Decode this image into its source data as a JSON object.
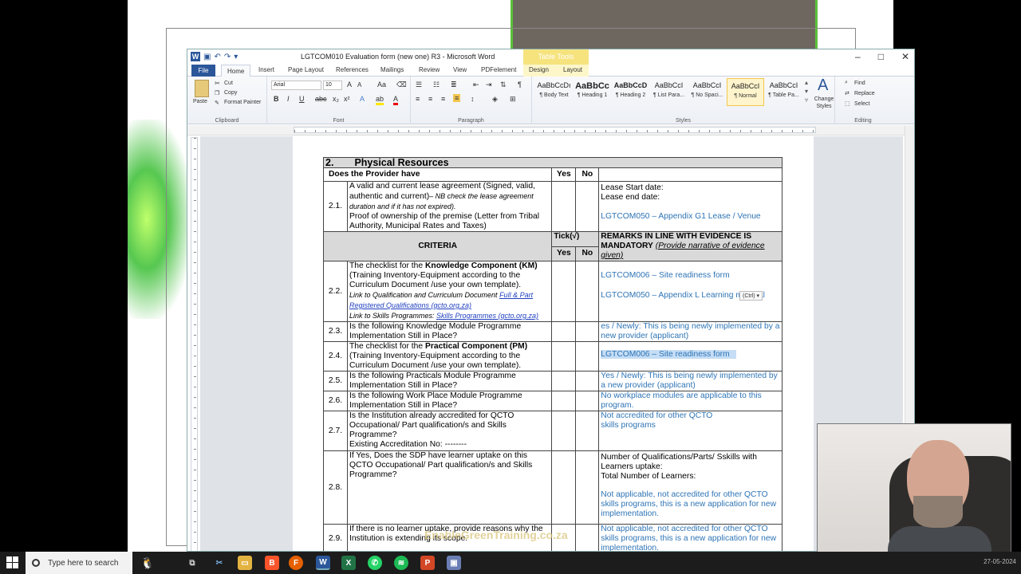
{
  "window": {
    "title": "LGTCOM010 Evaluation form (new one) R3 - Microsoft Word",
    "context_tab": "Table Tools",
    "minimize": "–",
    "maximize": "□",
    "close": "✕"
  },
  "tabs": [
    "File",
    "Home",
    "Insert",
    "Page Layout",
    "References",
    "Mailings",
    "Review",
    "View",
    "PDFelement",
    "Design",
    "Layout"
  ],
  "ribbon": {
    "clipboard": {
      "label": "Clipboard",
      "paste": "Paste",
      "cut": "Cut",
      "copy": "Copy",
      "format_painter": "Format Painter"
    },
    "font": {
      "label": "Font",
      "name": "Arial",
      "size": "10"
    },
    "paragraph": {
      "label": "Paragraph"
    },
    "styles": {
      "label": "Styles",
      "items": [
        {
          "preview": "AaBbCcDı",
          "name": "¶ Body Text"
        },
        {
          "preview": "AaBbCc",
          "name": "¶ Heading 1"
        },
        {
          "preview": "AaBbCcD",
          "name": "¶ Heading 2"
        },
        {
          "preview": "AaBbCcI",
          "name": "¶ List Para..."
        },
        {
          "preview": "AaBbCcI",
          "name": "¶ No Spaci..."
        },
        {
          "preview": "AaBbCcI",
          "name": "¶ Normal"
        },
        {
          "preview": "AaBbCcI",
          "name": "¶ Table Pa..."
        }
      ],
      "change_styles": "Change Styles"
    },
    "editing": {
      "label": "Editing",
      "find": "Find",
      "replace": "Replace",
      "select": "Select"
    }
  },
  "doc": {
    "section_number": "2.",
    "section_title": "Physical Resources",
    "provider_header": "Does the Provider have",
    "yes": "Yes",
    "no": "No",
    "tick": "Tick(√)",
    "criteria": "CRITERIA",
    "remarks_bold": "REMARKS IN LINE WITH EVIDENCE IS MANDATORY",
    "remarks_italic": "(Provide narrative of evidence given)",
    "row21": {
      "num": "2.1.",
      "a": "A valid and current lease agreement (Signed, valid, authentic and current)",
      "a_note": "– NB check the lease agreement duration and if it has not expired).",
      "b": "Proof of ownership of the premise (Letter from Tribal Authority, Municipal Rates and Taxes)",
      "r1": "Lease Start date:",
      "r2": "Lease end date:",
      "r3": "LGTCOM050 – Appendix G1 Lease / Venue"
    },
    "row22": {
      "num": "2.2.",
      "a_pre": "The checklist for the ",
      "a_bold": "Knowledge Component (KM)",
      "a_post": "(Training Inventory-Equipment according to the Curriculum Document /use your own template).",
      "l1_pre": "Link to Qualification and Curriculum Document ",
      "l1_link": "Full & Part Registered Qualifications (qcto.org.za)",
      "l2_pre": "Link to Skills Programmes: ",
      "l2_link": "Skills Programmes (qcto.org.za)",
      "r1": "LGTCOM006 – Site readiness form",
      "r2": "LGTCOM050 – Appendix L Learning material",
      "paste_badge": "(Ctrl) ▾"
    },
    "row23": {
      "num": "2.3.",
      "a": "Is the following Knowledge Module Programme Implementation Still in Place?",
      "r": "es / Newly: This is being newly implemented by a new provider (applicant)"
    },
    "row24": {
      "num": "2.4.",
      "a_pre": "The checklist for the ",
      "a_bold": "Practical Component (PM)",
      "a_post": "(Training Inventory-Equipment according to the Curriculum Document /use your own template).",
      "r": "LGTCOM006 – Site readiness form"
    },
    "row25": {
      "num": "2.5.",
      "a": "Is the following Practicals Module Programme Implementation Still in Place?",
      "r": "Yes / Newly: This is being newly implemented by a new provider (applicant)"
    },
    "row26": {
      "num": "2.6.",
      "a": "Is the following Work Place Module Programme Implementation Still in Place?",
      "r": "No workplace modules are applicable to this program."
    },
    "row27": {
      "num": "2.7.",
      "a": "Is the Institution already accredited for QCTO Occupational/ Part qualification/s and Skills Programme?",
      "a2": "Existing Accreditation No: --------",
      "r": "Not accredited for other QCTO skills programs"
    },
    "row28": {
      "num": "2.8.",
      "a": "If Yes, Does the SDP have learner uptake on this QCTO Occupational/ Part qualification/s and Skills Programme?",
      "r1": "Number of Qualifications/Parts/ Sskills with Learners uptake:",
      "r2": "Total Number of Learners:",
      "r3": "Not applicable, not accredited for other QCTO skills programs, this is a new application for new implementation."
    },
    "row29": {
      "num": "2.9.",
      "a": "If there is no learner uptake, provide reasons why the Institution is extending its scope.",
      "r": "Not applicable, not accredited for other QCTO skills programs, this is a new application for new implementation."
    },
    "watermark": "EnableGreenTraining.co.za"
  },
  "taskbar": {
    "search_placeholder": "Type here to search",
    "clock": "27-05-2024"
  },
  "colors": {
    "accent": "#2b579a",
    "remark_blue": "#2e74b5",
    "table_header": "#d9d9d9"
  }
}
